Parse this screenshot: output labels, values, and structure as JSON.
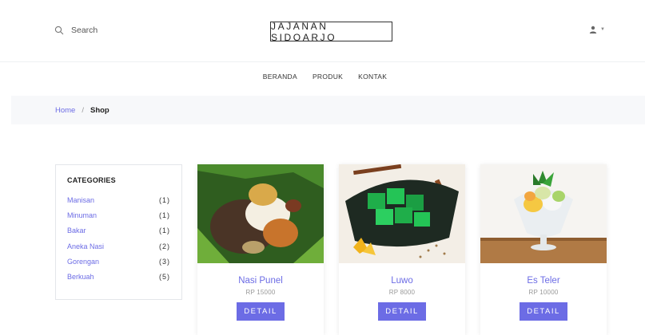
{
  "header": {
    "search_label": "Search",
    "logo_text": "JAJANAN SIDOARJO",
    "user_icon": "user-icon"
  },
  "nav": {
    "items": [
      {
        "label": "BERANDA"
      },
      {
        "label": "PRODUK"
      },
      {
        "label": "KONTAK"
      }
    ]
  },
  "breadcrumb": {
    "home": "Home",
    "separator": "/",
    "current": "Shop"
  },
  "categories": {
    "title": "CATEGORIES",
    "items": [
      {
        "name": "Manisan",
        "count": "(1)"
      },
      {
        "name": "Minuman",
        "count": "(1)"
      },
      {
        "name": "Bakar",
        "count": "(1)"
      },
      {
        "name": "Aneka Nasi",
        "count": "(2)"
      },
      {
        "name": "Gorengan",
        "count": "(3)"
      },
      {
        "name": "Berkuah",
        "count": "(5)"
      }
    ]
  },
  "products": [
    {
      "name": "Nasi Punel",
      "price": "RP 15000",
      "button": "DETAIL"
    },
    {
      "name": "Luwo",
      "price": "RP 8000",
      "button": "DETAIL"
    },
    {
      "name": "Es Teler",
      "price": "RP 10000",
      "button": "DETAIL"
    }
  ],
  "colors": {
    "accent": "#6c6ce5",
    "breadcrumb_bg": "#f7f8fa"
  }
}
